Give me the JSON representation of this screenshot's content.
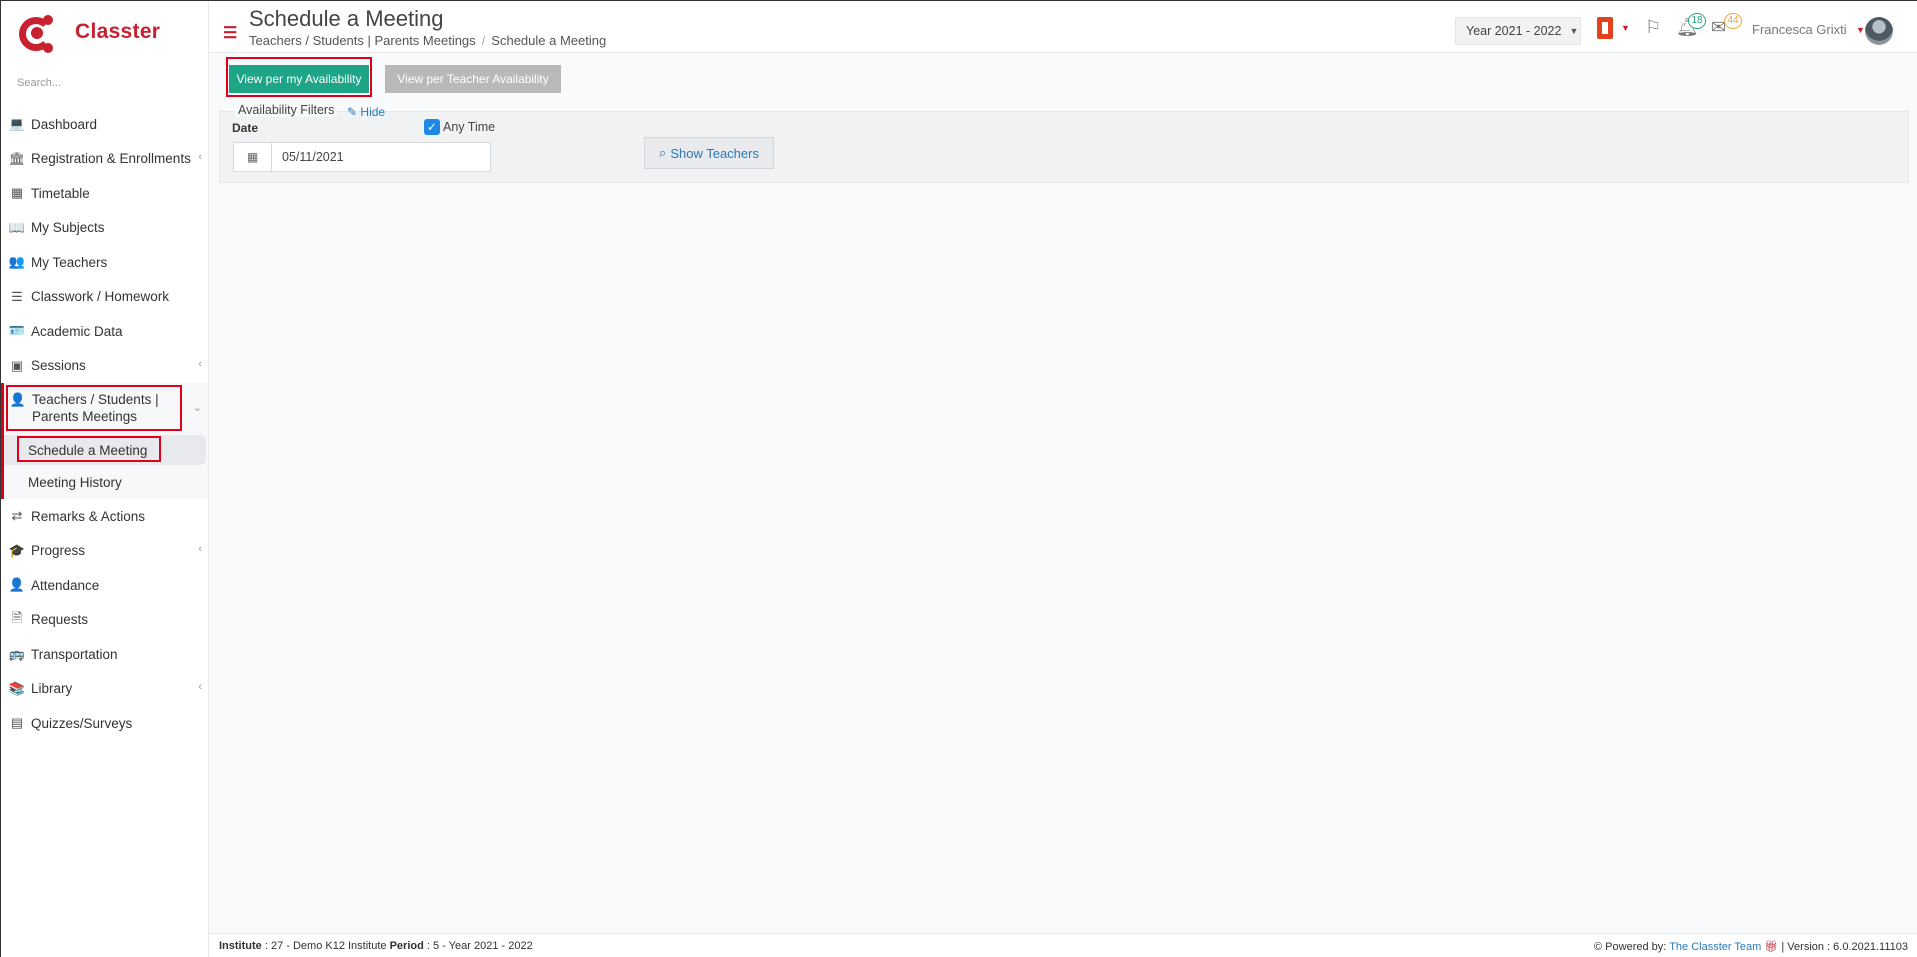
{
  "app": {
    "brand_name": "Classter"
  },
  "sidebar": {
    "search_placeholder": "Search...",
    "items": [
      {
        "label": "Dashboard",
        "icon": "laptop-icon"
      },
      {
        "label": "Registration & Enrollments",
        "icon": "bank-icon",
        "has_chevron": true
      },
      {
        "label": "Timetable",
        "icon": "calendar-icon"
      },
      {
        "label": "My Subjects",
        "icon": "book-icon"
      },
      {
        "label": "My Teachers",
        "icon": "users-icon"
      },
      {
        "label": "Classwork / Homework",
        "icon": "tasks-icon"
      },
      {
        "label": "Academic Data",
        "icon": "id-card-icon"
      },
      {
        "label": "Sessions",
        "icon": "chalkboard-icon",
        "has_chevron": true
      },
      {
        "label": "Teachers / Students | Parents Meetings",
        "icon": "user-clock-icon",
        "active": true
      },
      {
        "label": "Remarks & Actions",
        "icon": "shuffle-icon"
      },
      {
        "label": "Progress",
        "icon": "graduation-cap-icon",
        "has_chevron": true
      },
      {
        "label": "Attendance",
        "icon": "user-x-icon"
      },
      {
        "label": "Requests",
        "icon": "file-icon"
      },
      {
        "label": "Transportation",
        "icon": "bus-icon"
      },
      {
        "label": "Library",
        "icon": "books-icon",
        "has_chevron": true
      },
      {
        "label": "Quizzes/Surveys",
        "icon": "list-icon"
      }
    ],
    "subitems": [
      {
        "label": "Schedule a Meeting",
        "current": true
      },
      {
        "label": "Meeting History"
      }
    ],
    "chevron_left": "‹",
    "chevron_down": "⌄"
  },
  "header": {
    "title": "Schedule a Meeting",
    "breadcrumb": [
      "Teachers / Students | Parents Meetings",
      "Schedule a Meeting"
    ],
    "breadcrumb_sep": "/",
    "year": "Year 2021 - 2022",
    "notifications_count": "18",
    "messages_count": "44",
    "user_name": "Francesca Grixti"
  },
  "main": {
    "btn_my_availability": "View per my Availability",
    "btn_teacher_availability": "View per Teacher Availability",
    "filters_title": "Availability Filters",
    "hide_label": "Hide",
    "date_label": "Date",
    "date_value": "05/11/2021",
    "any_time_label": "Any Time",
    "any_time_checked": true,
    "show_teachers_label": "Show Teachers"
  },
  "footer": {
    "institute_label": "Institute",
    "institute_value": ": 27 - Demo K12 Institute",
    "period_label": "Period",
    "period_value": ": 5 - Year 2021 - 2022",
    "powered_by": "Powered by:",
    "powered_link": "The Classter Team",
    "version": "| Version : 6.0.2021.11103"
  },
  "colors": {
    "brand": "#c8202f",
    "highlight": "#e0001b",
    "primary_button": "#1ea586",
    "link": "#2a7ab8"
  }
}
